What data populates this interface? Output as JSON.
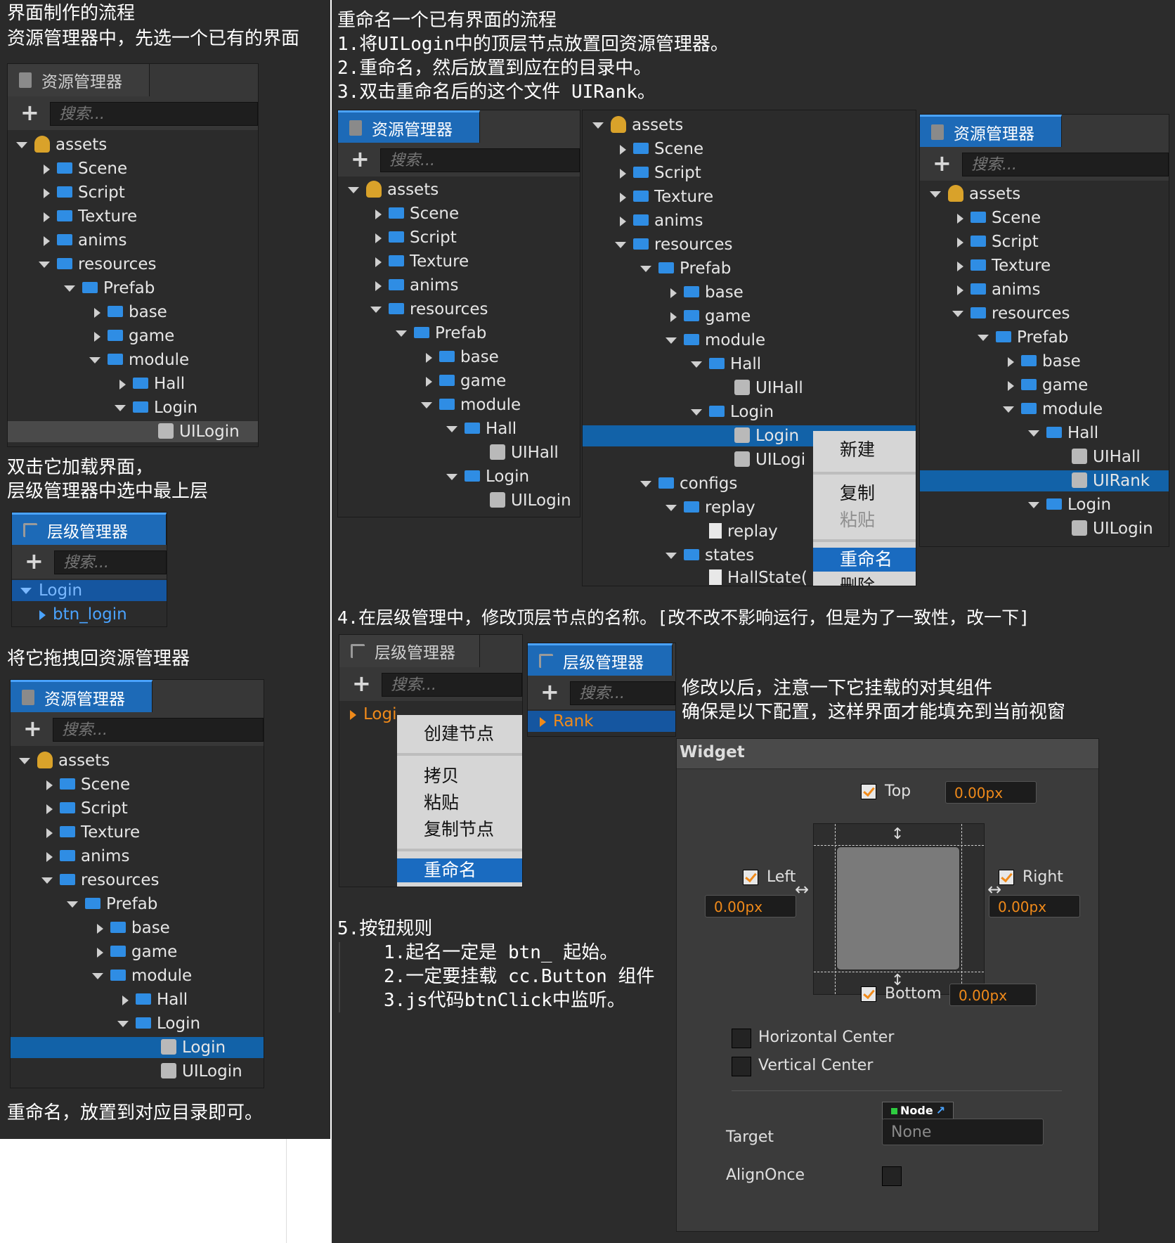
{
  "left_column": {
    "title": "界面制作的流程",
    "step1": "资源管理器中，先选一个已有的界面",
    "step2_line1": "双击它加载界面，",
    "step2_line2": "层级管理器中选中最上层",
    "step3": "将它拖拽回资源管理器",
    "step4": "重命名，放置到对应目录即可。"
  },
  "right_column": {
    "title": "重命名一个已有界面的流程",
    "step1": "1.将UILogin中的顶层节点放置回资源管理器。",
    "step2": "2.重命名，然后放置到应在的目录中。",
    "step3": "3.双击重命名后的这个文件 UIRank。",
    "step4": "4.在层级管理中，修改顶层节点的名称。[改不改不影响运行，但是为了一致性，改一下]",
    "after_note_line1": "修改以后，注意一下它挂载的对其组件",
    "after_note_line2": "确保是以下配置，这样界面才能填充到当前视窗",
    "step5": "5.按钮规则",
    "rule1": "1.起名一定是 btn_ 起始。",
    "rule2": "2.一定要挂载 cc.Button 组件",
    "rule3": "3.js代码btnClick中监听。"
  },
  "asset_panel": {
    "tab": "资源管理器",
    "search_placeholder": "搜索..."
  },
  "hier_panel": {
    "tab": "层级管理器",
    "search_placeholder": "搜索..."
  },
  "tree_items": {
    "assets": "assets",
    "scene": "Scene",
    "script": "Script",
    "texture": "Texture",
    "anims": "anims",
    "resources": "resources",
    "prefab": "Prefab",
    "base": "base",
    "game": "game",
    "module": "module",
    "hall": "Hall",
    "login": "Login",
    "uihall": "UIHall",
    "uilogin": "UILogin",
    "uirank": "UIRank",
    "configs": "configs",
    "replay": "replay",
    "states": "states",
    "hallstate": "HallState(",
    "uilogi_trunc": "UILogi",
    "btn_login": "btn_login",
    "rank": "Rank",
    "logi_trunc": "Logi"
  },
  "asset_menu": {
    "new": "新建",
    "copy": "复制",
    "paste": "粘贴",
    "rename": "重命名",
    "delete_partial": "删除"
  },
  "hier_menu": {
    "create_node": "创建节点",
    "copy": "拷贝",
    "paste": "粘贴",
    "duplicate": "复制节点",
    "rename": "重命名"
  },
  "widget": {
    "title": "Widget",
    "top_label": "Top",
    "top_value": "0.00px",
    "left_label": "Left",
    "left_value": "0.00px",
    "right_label": "Right",
    "right_value": "0.00px",
    "bottom_label": "Bottom",
    "bottom_value": "0.00px",
    "hcenter": "Horizontal Center",
    "vcenter": "Vertical Center",
    "node_tag": "Node",
    "target_label": "Target",
    "target_value": "None",
    "alignonce": "AlignOnce"
  },
  "colors": {
    "accent_blue": "#1d6ab7",
    "selection_blue": "#1262a8",
    "orange": "#f08a1a",
    "folder_blue": "#2f8de4"
  }
}
